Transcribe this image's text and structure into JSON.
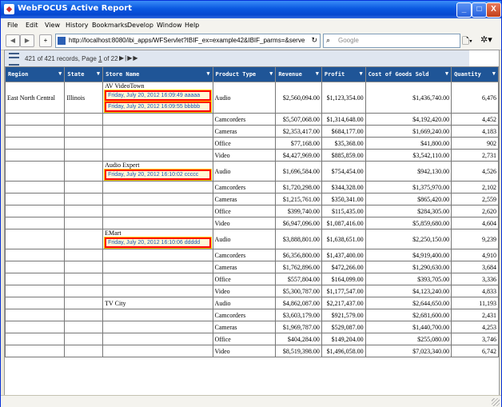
{
  "window": {
    "title": "WebFOCUS Active Report",
    "min_label": "_",
    "max_label": "□",
    "close_label": "X"
  },
  "menu": [
    "File",
    "Edit",
    "View",
    "History",
    "Bookmarks",
    "Develop",
    "Window",
    "Help"
  ],
  "nav": {
    "back": "◀",
    "forward": "▶",
    "add": "+",
    "url": "http://localhost:8080/ibi_apps/WFServlet?IBIF_ex=example42&IBIF_parms=&serve",
    "reload": "↻",
    "search_placeholder": "Google",
    "search_icon": "⌕",
    "page_icon": "🗋▾",
    "gear_icon": "✲▾"
  },
  "pager": {
    "prefix": "421 of 421 records, Page ",
    "page": "1",
    "suffix": " of 22",
    "controls": "▶|▶▶"
  },
  "table": {
    "columns": [
      "Region",
      "State",
      "Store Name",
      "Product Type",
      "Revenue",
      "Profit",
      "Cost of Goods Sold",
      "Quantity"
    ],
    "sort_icon": "▼",
    "groups": [
      {
        "region": "East North Central",
        "state": "Illinois",
        "store": "AV VideoTown",
        "stamps": [
          {
            "date": "Friday, July 20, 2012 16:09:49",
            "tag": "aaaaa"
          },
          {
            "date": "Friday, July 20, 2012 16:09:55",
            "tag": "bbbbb"
          }
        ],
        "rows": [
          {
            "product": "Audio",
            "revenue": "$2,560,094.00",
            "profit": "$1,123,354.00",
            "cogs": "$1,436,740.00",
            "qty": "6,476"
          },
          {
            "product": "Camcorders",
            "revenue": "$5,507,068.00",
            "profit": "$1,314,648.00",
            "cogs": "$4,192,420.00",
            "qty": "4,452"
          },
          {
            "product": "Cameras",
            "revenue": "$2,353,417.00",
            "profit": "$684,177.00",
            "cogs": "$1,669,240.00",
            "qty": "4,183"
          },
          {
            "product": "Office",
            "revenue": "$77,168.00",
            "profit": "$35,368.00",
            "cogs": "$41,800.00",
            "qty": "902"
          },
          {
            "product": "Video",
            "revenue": "$4,427,969.00",
            "profit": "$885,859.00",
            "cogs": "$3,542,110.00",
            "qty": "2,731"
          }
        ]
      },
      {
        "region": "",
        "state": "",
        "store": "Audio Expert",
        "stamps": [
          {
            "date": "Friday, July 20, 2012 16:10:02",
            "tag": "ccccc"
          }
        ],
        "rows": [
          {
            "product": "Audio",
            "revenue": "$1,696,584.00",
            "profit": "$754,454.00",
            "cogs": "$942,130.00",
            "qty": "4,526"
          },
          {
            "product": "Camcorders",
            "revenue": "$1,720,298.00",
            "profit": "$344,328.00",
            "cogs": "$1,375,970.00",
            "qty": "2,102"
          },
          {
            "product": "Cameras",
            "revenue": "$1,215,761.00",
            "profit": "$350,341.00",
            "cogs": "$865,420.00",
            "qty": "2,559"
          },
          {
            "product": "Office",
            "revenue": "$399,740.00",
            "profit": "$115,435.00",
            "cogs": "$284,305.00",
            "qty": "2,620"
          },
          {
            "product": "Video",
            "revenue": "$6,947,096.00",
            "profit": "$1,087,416.00",
            "cogs": "$5,859,680.00",
            "qty": "4,604"
          }
        ]
      },
      {
        "region": "",
        "state": "",
        "store": "EMart",
        "stamps": [
          {
            "date": "Friday, July 20, 2012 16:10:06",
            "tag": "ddddd"
          }
        ],
        "rows": [
          {
            "product": "Audio",
            "revenue": "$3,888,801.00",
            "profit": "$1,638,651.00",
            "cogs": "$2,250,150.00",
            "qty": "9,239"
          },
          {
            "product": "Camcorders",
            "revenue": "$6,356,800.00",
            "profit": "$1,437,400.00",
            "cogs": "$4,919,400.00",
            "qty": "4,910"
          },
          {
            "product": "Cameras",
            "revenue": "$1,762,896.00",
            "profit": "$472,266.00",
            "cogs": "$1,290,630.00",
            "qty": "3,684"
          },
          {
            "product": "Office",
            "revenue": "$557,804.00",
            "profit": "$164,099.00",
            "cogs": "$393,705.00",
            "qty": "3,336"
          },
          {
            "product": "Video",
            "revenue": "$5,300,787.00",
            "profit": "$1,177,547.00",
            "cogs": "$4,123,240.00",
            "qty": "4,833"
          }
        ]
      },
      {
        "region": "",
        "state": "",
        "store": "TV City",
        "stamps": [],
        "rows": [
          {
            "product": "Audio",
            "revenue": "$4,862,087.00",
            "profit": "$2,217,437.00",
            "cogs": "$2,644,650.00",
            "qty": "11,193"
          },
          {
            "product": "Camcorders",
            "revenue": "$3,603,179.00",
            "profit": "$921,579.00",
            "cogs": "$2,681,600.00",
            "qty": "2,431"
          },
          {
            "product": "Cameras",
            "revenue": "$1,969,787.00",
            "profit": "$529,087.00",
            "cogs": "$1,440,700.00",
            "qty": "4,253"
          },
          {
            "product": "Office",
            "revenue": "$404,284.00",
            "profit": "$149,204.00",
            "cogs": "$255,080.00",
            "qty": "3,746"
          },
          {
            "product": "Video",
            "revenue": "$8,519,398.00",
            "profit": "$1,496,058.00",
            "cogs": "$7,023,340.00",
            "qty": "6,742"
          }
        ]
      }
    ]
  },
  "colors": {
    "header_bg": "#1f5597",
    "title_bg": "#0a58e0",
    "highlight_border": "#ff0000",
    "stamp_text": "#1a54b8"
  }
}
